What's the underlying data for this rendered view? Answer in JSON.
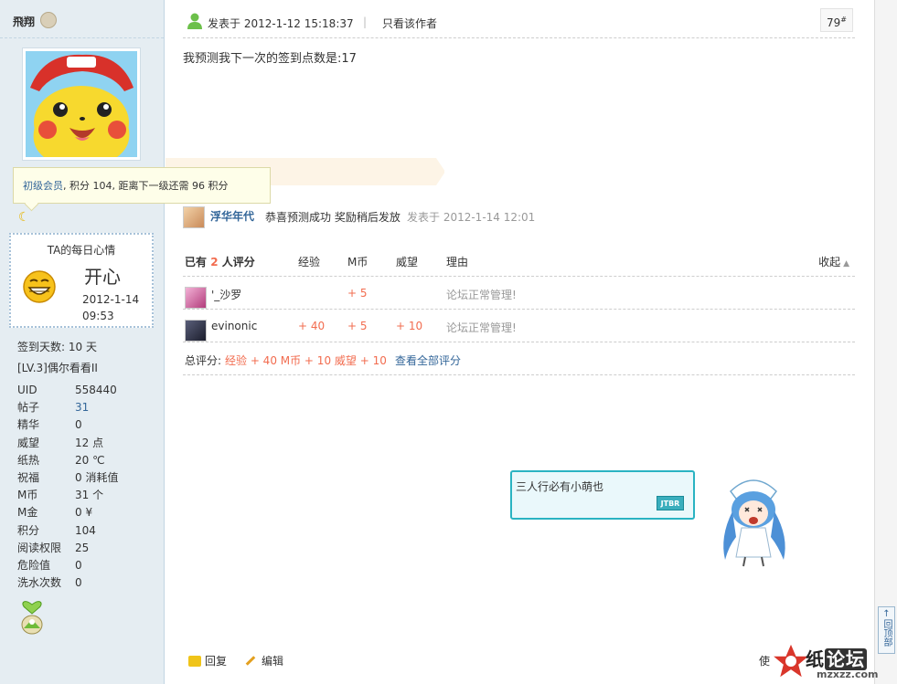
{
  "user": {
    "name": "飛翔",
    "tooltip_level": "初级会员",
    "tooltip_rest": ", 积分 104, 距离下一级还需 96 积分",
    "mood": {
      "title": "TA的每日心情",
      "text": "开心",
      "date": "2012-1-14",
      "time": "09:53"
    },
    "sign_days": "签到天数: 10 天",
    "level_title": "[LV.3]偶尔看看II",
    "stats": [
      {
        "key": "UID",
        "value": "558440"
      },
      {
        "key": "帖子",
        "value": "31"
      },
      {
        "key": "精华",
        "value": "0"
      },
      {
        "key": "威望",
        "value": "12 点"
      },
      {
        "key": "纸热",
        "value": "20 ℃"
      },
      {
        "key": "祝福",
        "value": "0 消耗值"
      },
      {
        "key": "M币",
        "value": "31 个"
      },
      {
        "key": "M金",
        "value": "0 ¥"
      },
      {
        "key": "积分",
        "value": "104"
      },
      {
        "key": "阅读权限",
        "value": "25"
      },
      {
        "key": "危险值",
        "value": "0"
      },
      {
        "key": "洗水次数",
        "value": "0"
      }
    ]
  },
  "post": {
    "posted_at": "发表于 2012-1-12 15:18:37",
    "separator": "|",
    "only_author": "只看该作者",
    "floor": "79",
    "floor_suffix": "#",
    "content": "我预测我下一次的签到点数是:17"
  },
  "comment": {
    "user": "浮华年代",
    "text": "恭喜预测成功 奖励稍后发放",
    "time": "发表于 2012-1-14 12:01"
  },
  "rating": {
    "title_pre": "已有 ",
    "count": "2",
    "title_post": " 人评分",
    "headers": {
      "exp": "经验",
      "m": "M币",
      "w": "威望",
      "reason": "理由"
    },
    "collapse": "收起",
    "rows": [
      {
        "name": "'_沙罗",
        "exp": "",
        "m": "+ 5",
        "w": "",
        "reason": "论坛正常管理!"
      },
      {
        "name": "evinonic",
        "exp": "+ 40",
        "m": "+ 5",
        "w": "+ 10",
        "reason": "论坛正常管理!"
      }
    ],
    "total_label": "总评分:",
    "total_values": "经验 + 40  M币 + 10  威望 + 10",
    "view_all": "查看全部评分"
  },
  "signature": {
    "text": "三人行必有小萌也",
    "stamp": "JTBR"
  },
  "footer": {
    "reply": "回复",
    "edit": "编辑",
    "use": "使"
  },
  "back_to_top": "回顶部",
  "watermark": {
    "logo_a": "纸",
    "logo_b": "论坛",
    "url": "mzxzz.com"
  },
  "colors": {
    "sidebar_bg": "#e5edf2",
    "link": "#336699",
    "rate_plus": "#f26c4f",
    "signature_border": "#2ab3c2"
  }
}
